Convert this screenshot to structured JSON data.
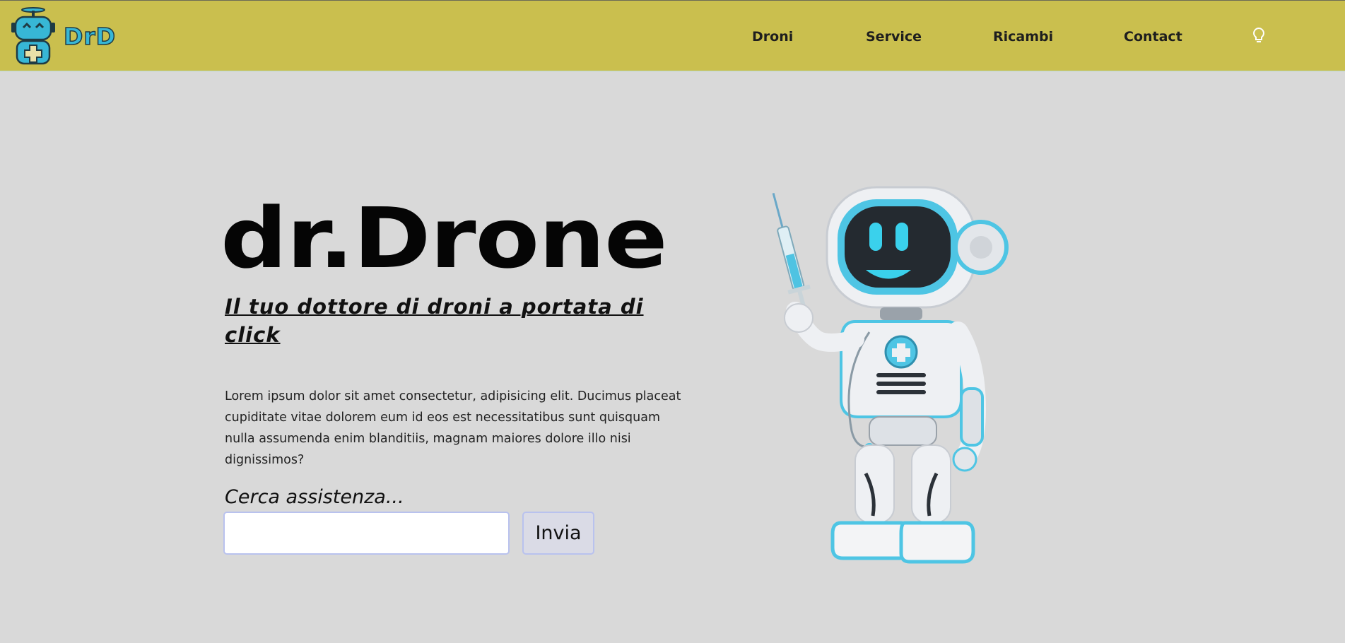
{
  "brand": {
    "logo_text": "DrD",
    "logo_icon": "drone-robot-logo-icon"
  },
  "nav": {
    "items": [
      {
        "label": "Droni"
      },
      {
        "label": "Service"
      },
      {
        "label": "Ricambi"
      },
      {
        "label": "Contact"
      }
    ],
    "theme_toggle_icon": "lightbulb-icon"
  },
  "hero": {
    "title": "dr.Drone",
    "subtitle": "Il tuo dottore di droni a portata di click",
    "text": "Lorem ipsum dolor sit amet consectetur, adipisicing elit. Ducimus placeat cupiditate vitae dolorem eum id eos est necessitatibus sunt quisquam nulla assumenda enim blanditiis, magnam maiores dolore illo nisi dignissimos?",
    "image_icon": "doctor-robot-illustration"
  },
  "search": {
    "label": "Cerca assistenza...",
    "value": "",
    "placeholder": "",
    "button_label": "Invia"
  },
  "colors": {
    "navbar": "#cabf4e",
    "background": "#d9d9d9",
    "accent": "#37b7d6",
    "input_border": "#b9c2ee"
  }
}
